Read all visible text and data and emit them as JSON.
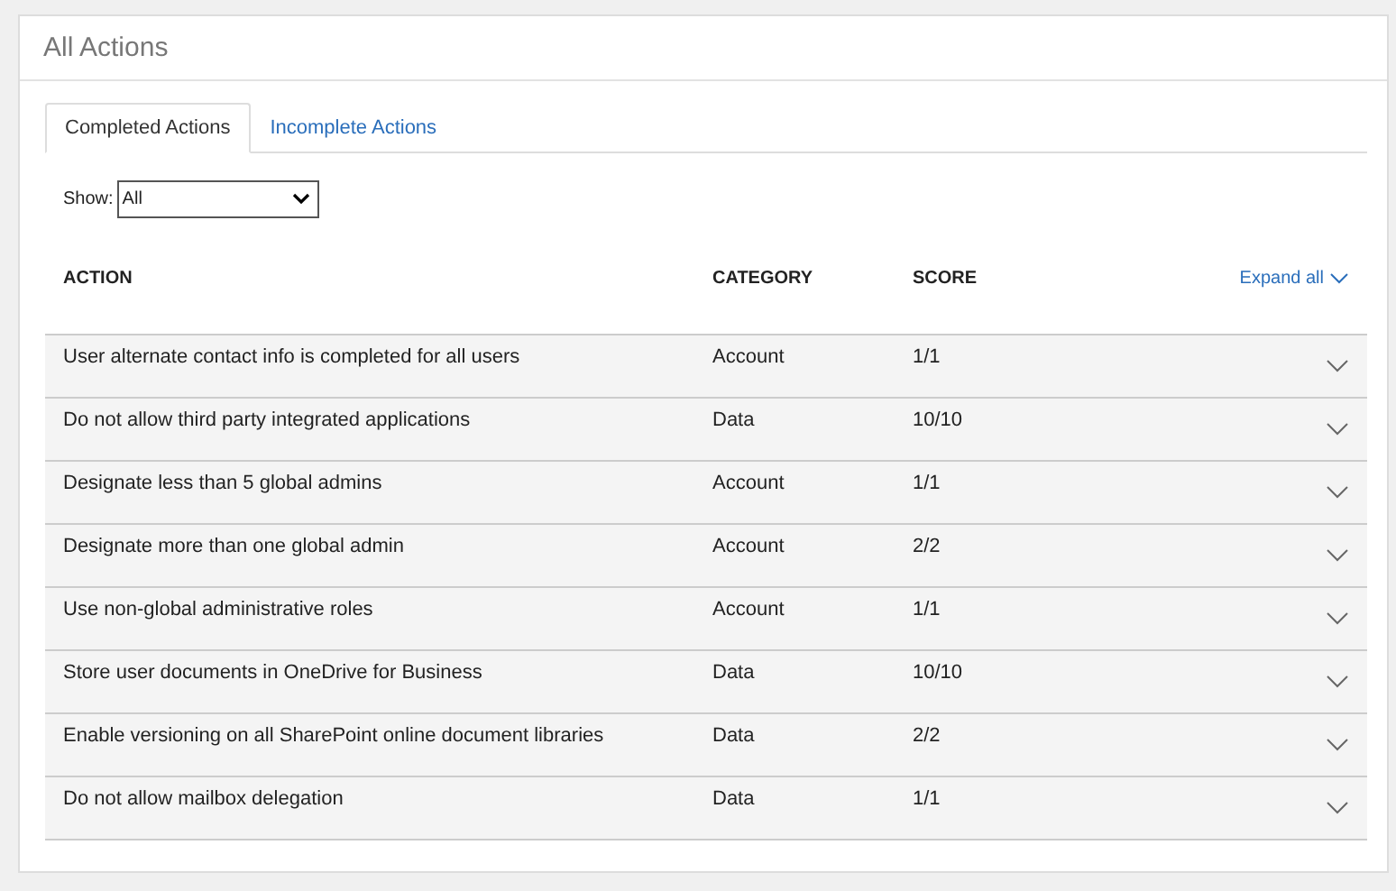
{
  "panel": {
    "title": "All Actions"
  },
  "tabs": [
    {
      "label": "Completed Actions",
      "selected": true
    },
    {
      "label": "Incomplete Actions",
      "selected": false
    }
  ],
  "filter": {
    "label": "Show:",
    "value": "All"
  },
  "table": {
    "columns": [
      "ACTION",
      "CATEGORY",
      "SCORE"
    ],
    "expand_all": "Expand all",
    "rows": [
      {
        "action": "User alternate contact info is completed for all users",
        "category": "Account",
        "score": "1/1"
      },
      {
        "action": "Do not allow third party integrated applications",
        "category": "Data",
        "score": "10/10"
      },
      {
        "action": "Designate less than 5 global admins",
        "category": "Account",
        "score": "1/1"
      },
      {
        "action": "Designate more than one global admin",
        "category": "Account",
        "score": "2/2"
      },
      {
        "action": "Use non-global administrative roles",
        "category": "Account",
        "score": "1/1"
      },
      {
        "action": "Store user documents in OneDrive for Business",
        "category": "Data",
        "score": "10/10"
      },
      {
        "action": "Enable versioning on all SharePoint online document libraries",
        "category": "Data",
        "score": "2/2"
      },
      {
        "action": "Do not allow mailbox delegation",
        "category": "Data",
        "score": "1/1"
      }
    ]
  }
}
